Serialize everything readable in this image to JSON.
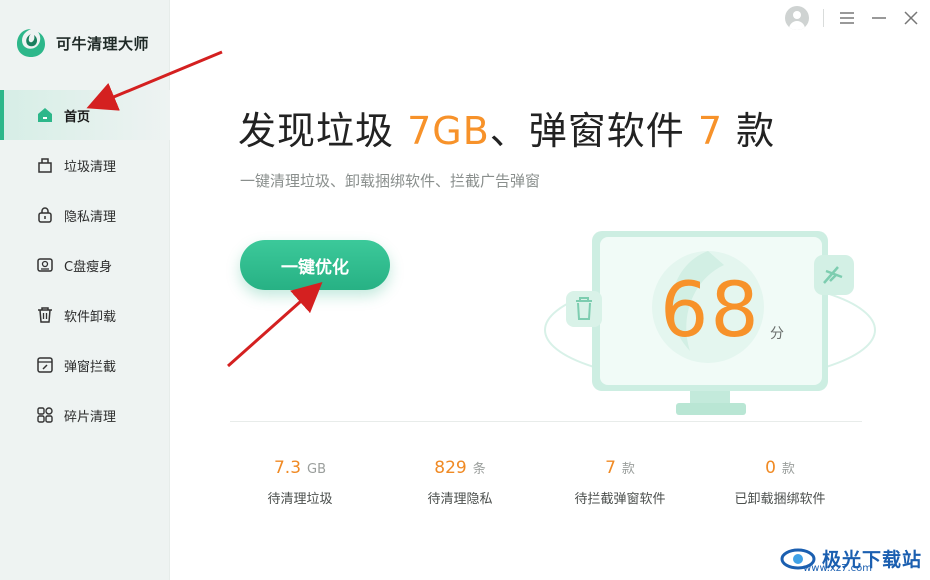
{
  "app": {
    "name": "可牛清理大师"
  },
  "sidebar": {
    "items": [
      {
        "label": "首页",
        "icon": "home-icon",
        "active": true
      },
      {
        "label": "垃圾清理",
        "icon": "trash-bag-icon"
      },
      {
        "label": "隐私清理",
        "icon": "lock-icon"
      },
      {
        "label": "C盘瘦身",
        "icon": "disk-icon"
      },
      {
        "label": "软件卸载",
        "icon": "bin-icon"
      },
      {
        "label": "弹窗拦截",
        "icon": "popup-block-icon"
      },
      {
        "label": "碎片清理",
        "icon": "grid-icon"
      }
    ]
  },
  "headline": {
    "part1": "发现垃圾 ",
    "size_value": "7GB",
    "part2": "、弹窗软件 ",
    "count_value": "7",
    "part3": " 款"
  },
  "subline": "一键清理垃圾、卸载捆绑软件、拦截广告弹窗",
  "optimize_button": "一键优化",
  "score": {
    "value": "68",
    "unit": "分"
  },
  "stats": [
    {
      "value": "7.3",
      "unit": "GB",
      "label": "待清理垃圾"
    },
    {
      "value": "829",
      "unit": "条",
      "label": "待清理隐私"
    },
    {
      "value": "7",
      "unit": "款",
      "label": "待拦截弹窗软件"
    },
    {
      "value": "0",
      "unit": "款",
      "label": "已卸载捆绑软件"
    }
  ],
  "watermark": {
    "text": "极光下载站",
    "url": "www.xz7.com"
  },
  "colors": {
    "accent": "#2db78a",
    "highlight": "#f7922a",
    "arrow": "#d42020"
  }
}
